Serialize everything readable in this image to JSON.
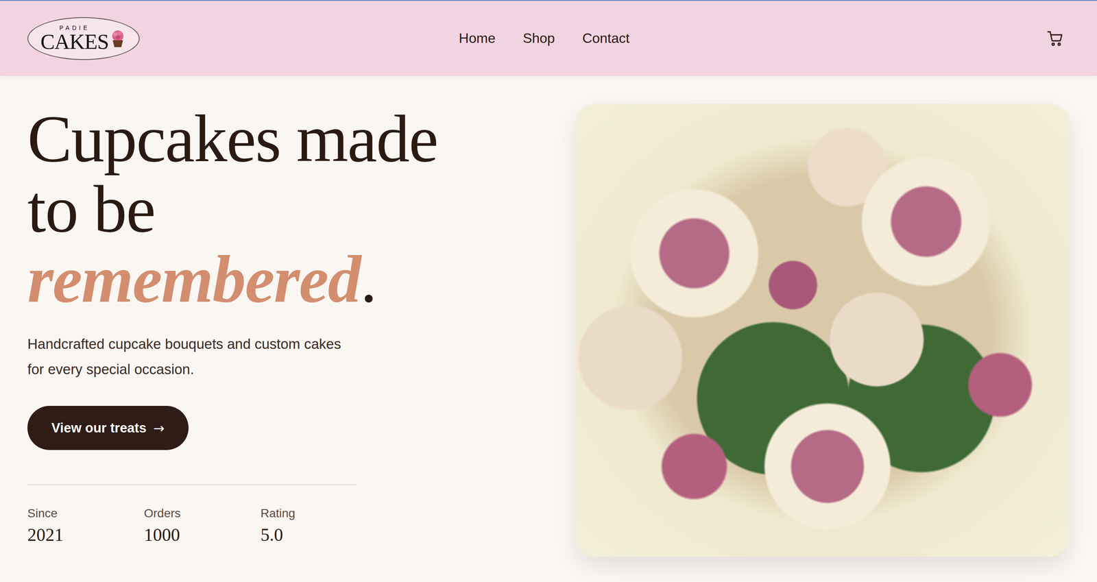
{
  "logo": {
    "top": "PADIE",
    "main": "CAKES"
  },
  "nav": [
    {
      "label": "Home"
    },
    {
      "label": "Shop"
    },
    {
      "label": "Contact"
    }
  ],
  "hero": {
    "title_lines": [
      "Cupcakes made",
      "to be"
    ],
    "accent": "remembered",
    "accent_end": ".",
    "subtitle_lines": [
      "Handcrafted cupcake bouquets and custom cakes",
      "for every special occasion."
    ],
    "button": "View our treats",
    "button_arrow": "→"
  },
  "stats": [
    {
      "label": "Since",
      "value": "2021"
    },
    {
      "label": "Orders",
      "value": "1000"
    },
    {
      "label": "Rating",
      "value": "5.0"
    }
  ]
}
